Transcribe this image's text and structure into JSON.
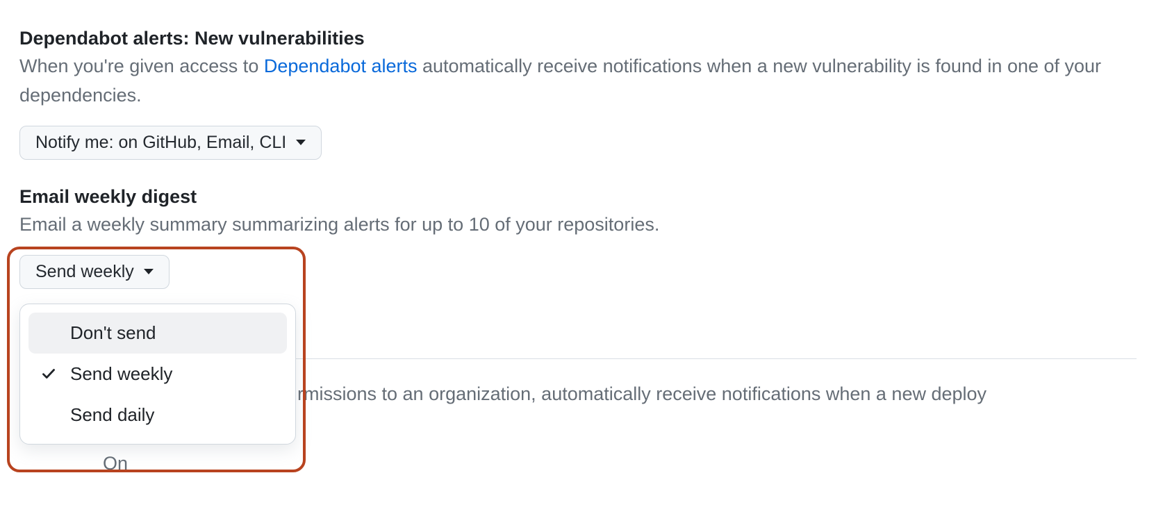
{
  "dependabot": {
    "title": "Dependabot alerts: New vulnerabilities",
    "desc_prefix": "When you're given access to ",
    "desc_link": "Dependabot alerts",
    "desc_suffix": " automatically receive notifications when a new vulnerability is found in one of your dependencies.",
    "notify_button": "Notify me: on GitHub, Email, CLI"
  },
  "digest": {
    "title": "Email weekly digest",
    "desc": "Email a weekly summary summarizing alerts for up to 10 of your repositories.",
    "button": "Send weekly",
    "options": {
      "dont_send": "Don't send",
      "send_weekly": "Send weekly",
      "send_daily": "Send daily"
    }
  },
  "lower": {
    "text_fragment": "rmissions to an organization, automatically receive notifications when a new deploy",
    "on_fragment": "On"
  }
}
